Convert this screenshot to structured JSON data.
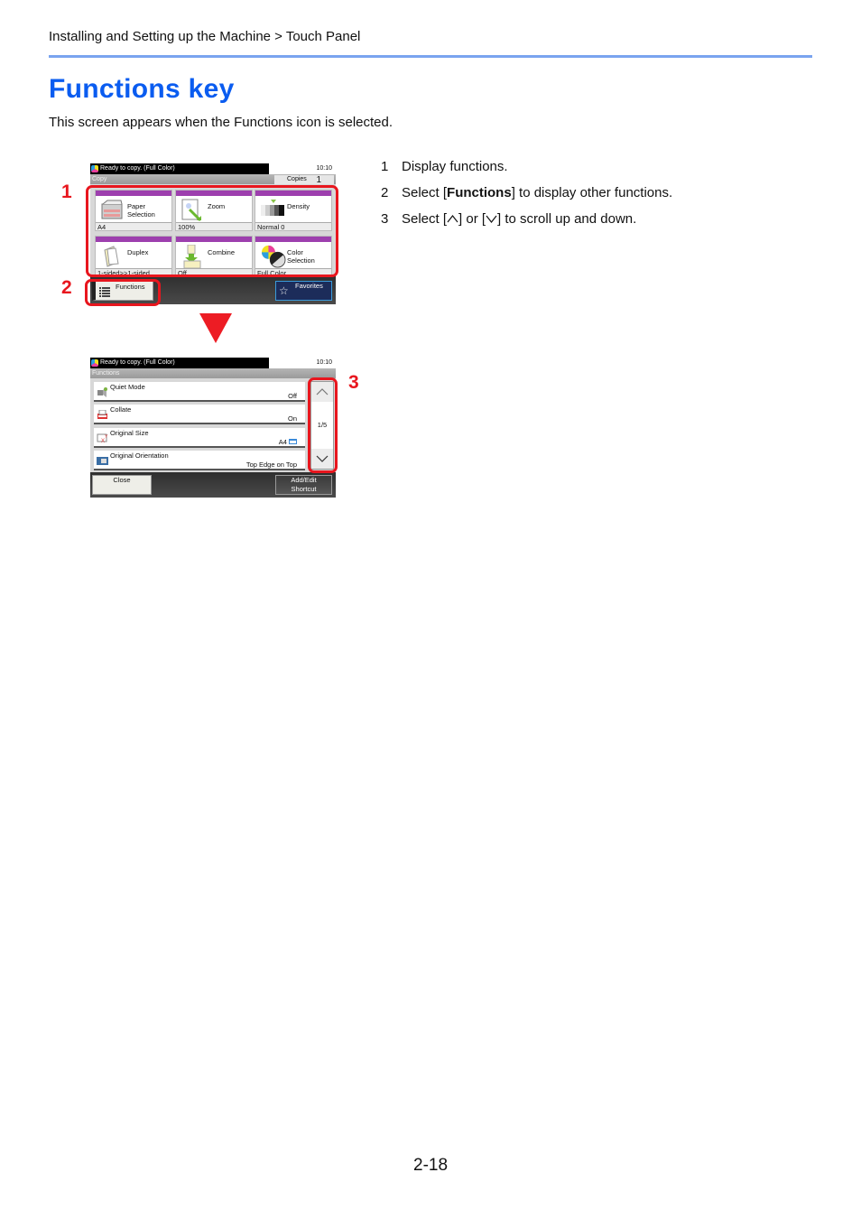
{
  "header": {
    "breadcrumb": "Installing and Setting up the Machine > Touch Panel",
    "rule_color": "#7aa4ef"
  },
  "title": "Functions key",
  "intro": "This screen appears when the Functions icon is selected.",
  "steps": [
    {
      "num": "1",
      "text": "Display functions."
    },
    {
      "num": "2",
      "pre": "Select [",
      "bold": "Functions",
      "post": "] to display other functions."
    },
    {
      "num": "3",
      "pre": "Select [",
      "mid": "] or [",
      "post": "] to scroll up and down.",
      "icons": [
        "chevron-up-icon",
        "chevron-down-icon"
      ]
    }
  ],
  "callouts": [
    "1",
    "2",
    "3"
  ],
  "colors": {
    "title": "#0a5cf0",
    "callout": "#e8161e",
    "tile_bar": "#9d3fae"
  },
  "copy_screen": {
    "status": "Ready to copy. (Full Color)",
    "time": "10:10",
    "title": "Copy",
    "copies_label": "Copies",
    "copies_value": "1",
    "tiles": [
      {
        "label": "Paper\nSelection",
        "label1": "Paper",
        "label2": "Selection",
        "value": "A4",
        "icon": "paper-tray-icon"
      },
      {
        "label1": "Zoom",
        "label2": "",
        "value": "100%",
        "icon": "zoom-icon"
      },
      {
        "label1": "Density",
        "label2": "",
        "value": "Normal 0",
        "icon": "density-icon"
      },
      {
        "label1": "Duplex",
        "label2": "",
        "value": "1-sided>>1-sided",
        "icon": "duplex-icon"
      },
      {
        "label1": "Combine",
        "label2": "",
        "value": "Off",
        "icon": "combine-icon"
      },
      {
        "label1": "Color",
        "label2": "Selection",
        "value": "Full Color",
        "icon": "color-selection-icon"
      }
    ],
    "functions_button": "Functions",
    "favorites_button": "Favorites"
  },
  "functions_screen": {
    "status": "Ready to copy. (Full Color)",
    "time": "10:10",
    "title": "Functions",
    "rows": [
      {
        "label": "Quiet Mode",
        "value": "Off",
        "icon": "quiet-mode-icon"
      },
      {
        "label": "Collate",
        "value": "On",
        "icon": "collate-icon"
      },
      {
        "label": "Original Size",
        "value": "A4",
        "icon": "original-size-icon"
      },
      {
        "label": "Original Orientation",
        "value": "Top Edge on Top",
        "icon": "original-orientation-icon"
      }
    ],
    "page_indicator": "1/5",
    "close_button": "Close",
    "shortcut_button_line1": "Add/Edit",
    "shortcut_button_line2": "Shortcut"
  },
  "page_number": "2-18"
}
